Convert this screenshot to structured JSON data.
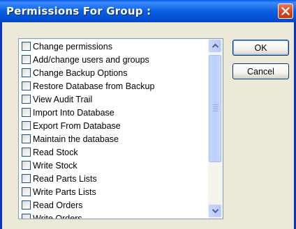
{
  "window": {
    "title": "Permissions For Group :"
  },
  "permissions": [
    {
      "label": "Change permissions",
      "checked": false
    },
    {
      "label": "Add/change users and groups",
      "checked": false
    },
    {
      "label": "Change Backup Options",
      "checked": false
    },
    {
      "label": "Restore Database from Backup",
      "checked": false
    },
    {
      "label": "View Audit Trail",
      "checked": false
    },
    {
      "label": "Import Into Database",
      "checked": false
    },
    {
      "label": "Export From Database",
      "checked": false
    },
    {
      "label": "Maintain the database",
      "checked": false
    },
    {
      "label": "Read Stock",
      "checked": false
    },
    {
      "label": "Write Stock",
      "checked": false
    },
    {
      "label": "Read Parts Lists",
      "checked": false
    },
    {
      "label": "Write Parts Lists",
      "checked": false
    },
    {
      "label": "Read Orders",
      "checked": false
    },
    {
      "label": "Write Orders",
      "checked": false
    }
  ],
  "buttons": {
    "ok": "OK",
    "cancel": "Cancel"
  },
  "icons": {
    "close": "close-icon",
    "scroll_up": "chevron-up-icon",
    "scroll_down": "chevron-down-icon"
  },
  "colors": {
    "titlebar": "#0A5BE8",
    "close": "#D84A24",
    "dialog_bg": "#ECE9D8"
  }
}
